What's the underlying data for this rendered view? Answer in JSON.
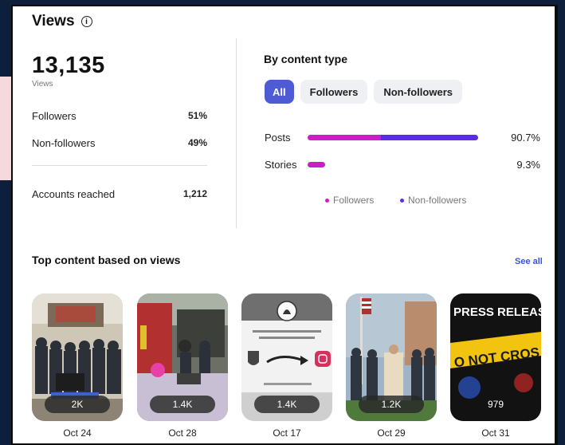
{
  "header": {
    "title": "Views"
  },
  "summary": {
    "total": "13,135",
    "total_label": "Views",
    "rows": [
      {
        "label": "Followers",
        "value": "51%"
      },
      {
        "label": "Non-followers",
        "value": "49%"
      },
      {
        "label": "Accounts reached",
        "value": "1,212"
      }
    ]
  },
  "by_content": {
    "title": "By content type",
    "filters": [
      "All",
      "Followers",
      "Non-followers"
    ],
    "active_filter": "All",
    "bars": [
      {
        "label": "Posts",
        "value": "90.7%",
        "fraction": 0.907,
        "followers_fraction": 0.43
      },
      {
        "label": "Stories",
        "value": "9.3%",
        "fraction": 0.093,
        "followers_fraction": 1.0
      }
    ],
    "legend": [
      "Followers",
      "Non-followers"
    ]
  },
  "top_content": {
    "title": "Top content based on views",
    "see_all": "See all",
    "items": [
      {
        "views": "2K",
        "date": "Oct 24"
      },
      {
        "views": "1.4K",
        "date": "Oct 28"
      },
      {
        "views": "1.4K",
        "date": "Oct 17"
      },
      {
        "views": "1.2K",
        "date": "Oct 29"
      },
      {
        "views": "979",
        "date": "Oct 31"
      }
    ],
    "thumb_texts": {
      "press_release": "PRESS RELEAS",
      "tape": "O NOT CROS"
    }
  },
  "colors": {
    "followers": "#c81fc6",
    "non_followers": "#5a2ee0",
    "accent": "#4f5bd5",
    "link": "#3a52e0"
  }
}
